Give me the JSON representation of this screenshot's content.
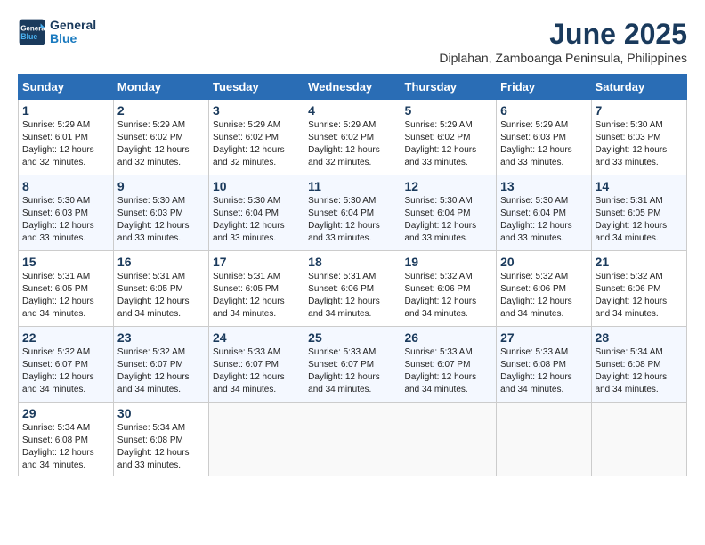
{
  "logo": {
    "line1": "General",
    "line2": "Blue"
  },
  "title": "June 2025",
  "location": "Diplahan, Zamboanga Peninsula, Philippines",
  "headers": [
    "Sunday",
    "Monday",
    "Tuesday",
    "Wednesday",
    "Thursday",
    "Friday",
    "Saturday"
  ],
  "weeks": [
    [
      {
        "day": "1",
        "sunrise": "5:29 AM",
        "sunset": "6:01 PM",
        "daylight": "12 hours and 32 minutes."
      },
      {
        "day": "2",
        "sunrise": "5:29 AM",
        "sunset": "6:02 PM",
        "daylight": "12 hours and 32 minutes."
      },
      {
        "day": "3",
        "sunrise": "5:29 AM",
        "sunset": "6:02 PM",
        "daylight": "12 hours and 32 minutes."
      },
      {
        "day": "4",
        "sunrise": "5:29 AM",
        "sunset": "6:02 PM",
        "daylight": "12 hours and 32 minutes."
      },
      {
        "day": "5",
        "sunrise": "5:29 AM",
        "sunset": "6:02 PM",
        "daylight": "12 hours and 33 minutes."
      },
      {
        "day": "6",
        "sunrise": "5:29 AM",
        "sunset": "6:03 PM",
        "daylight": "12 hours and 33 minutes."
      },
      {
        "day": "7",
        "sunrise": "5:30 AM",
        "sunset": "6:03 PM",
        "daylight": "12 hours and 33 minutes."
      }
    ],
    [
      {
        "day": "8",
        "sunrise": "5:30 AM",
        "sunset": "6:03 PM",
        "daylight": "12 hours and 33 minutes."
      },
      {
        "day": "9",
        "sunrise": "5:30 AM",
        "sunset": "6:03 PM",
        "daylight": "12 hours and 33 minutes."
      },
      {
        "day": "10",
        "sunrise": "5:30 AM",
        "sunset": "6:04 PM",
        "daylight": "12 hours and 33 minutes."
      },
      {
        "day": "11",
        "sunrise": "5:30 AM",
        "sunset": "6:04 PM",
        "daylight": "12 hours and 33 minutes."
      },
      {
        "day": "12",
        "sunrise": "5:30 AM",
        "sunset": "6:04 PM",
        "daylight": "12 hours and 33 minutes."
      },
      {
        "day": "13",
        "sunrise": "5:30 AM",
        "sunset": "6:04 PM",
        "daylight": "12 hours and 33 minutes."
      },
      {
        "day": "14",
        "sunrise": "5:31 AM",
        "sunset": "6:05 PM",
        "daylight": "12 hours and 34 minutes."
      }
    ],
    [
      {
        "day": "15",
        "sunrise": "5:31 AM",
        "sunset": "6:05 PM",
        "daylight": "12 hours and 34 minutes."
      },
      {
        "day": "16",
        "sunrise": "5:31 AM",
        "sunset": "6:05 PM",
        "daylight": "12 hours and 34 minutes."
      },
      {
        "day": "17",
        "sunrise": "5:31 AM",
        "sunset": "6:05 PM",
        "daylight": "12 hours and 34 minutes."
      },
      {
        "day": "18",
        "sunrise": "5:31 AM",
        "sunset": "6:06 PM",
        "daylight": "12 hours and 34 minutes."
      },
      {
        "day": "19",
        "sunrise": "5:32 AM",
        "sunset": "6:06 PM",
        "daylight": "12 hours and 34 minutes."
      },
      {
        "day": "20",
        "sunrise": "5:32 AM",
        "sunset": "6:06 PM",
        "daylight": "12 hours and 34 minutes."
      },
      {
        "day": "21",
        "sunrise": "5:32 AM",
        "sunset": "6:06 PM",
        "daylight": "12 hours and 34 minutes."
      }
    ],
    [
      {
        "day": "22",
        "sunrise": "5:32 AM",
        "sunset": "6:07 PM",
        "daylight": "12 hours and 34 minutes."
      },
      {
        "day": "23",
        "sunrise": "5:32 AM",
        "sunset": "6:07 PM",
        "daylight": "12 hours and 34 minutes."
      },
      {
        "day": "24",
        "sunrise": "5:33 AM",
        "sunset": "6:07 PM",
        "daylight": "12 hours and 34 minutes."
      },
      {
        "day": "25",
        "sunrise": "5:33 AM",
        "sunset": "6:07 PM",
        "daylight": "12 hours and 34 minutes."
      },
      {
        "day": "26",
        "sunrise": "5:33 AM",
        "sunset": "6:07 PM",
        "daylight": "12 hours and 34 minutes."
      },
      {
        "day": "27",
        "sunrise": "5:33 AM",
        "sunset": "6:08 PM",
        "daylight": "12 hours and 34 minutes."
      },
      {
        "day": "28",
        "sunrise": "5:34 AM",
        "sunset": "6:08 PM",
        "daylight": "12 hours and 34 minutes."
      }
    ],
    [
      {
        "day": "29",
        "sunrise": "5:34 AM",
        "sunset": "6:08 PM",
        "daylight": "12 hours and 34 minutes."
      },
      {
        "day": "30",
        "sunrise": "5:34 AM",
        "sunset": "6:08 PM",
        "daylight": "12 hours and 33 minutes."
      },
      null,
      null,
      null,
      null,
      null
    ]
  ],
  "labels": {
    "sunrise_prefix": "Sunrise: ",
    "sunset_prefix": "Sunset: ",
    "daylight_prefix": "Daylight: "
  }
}
